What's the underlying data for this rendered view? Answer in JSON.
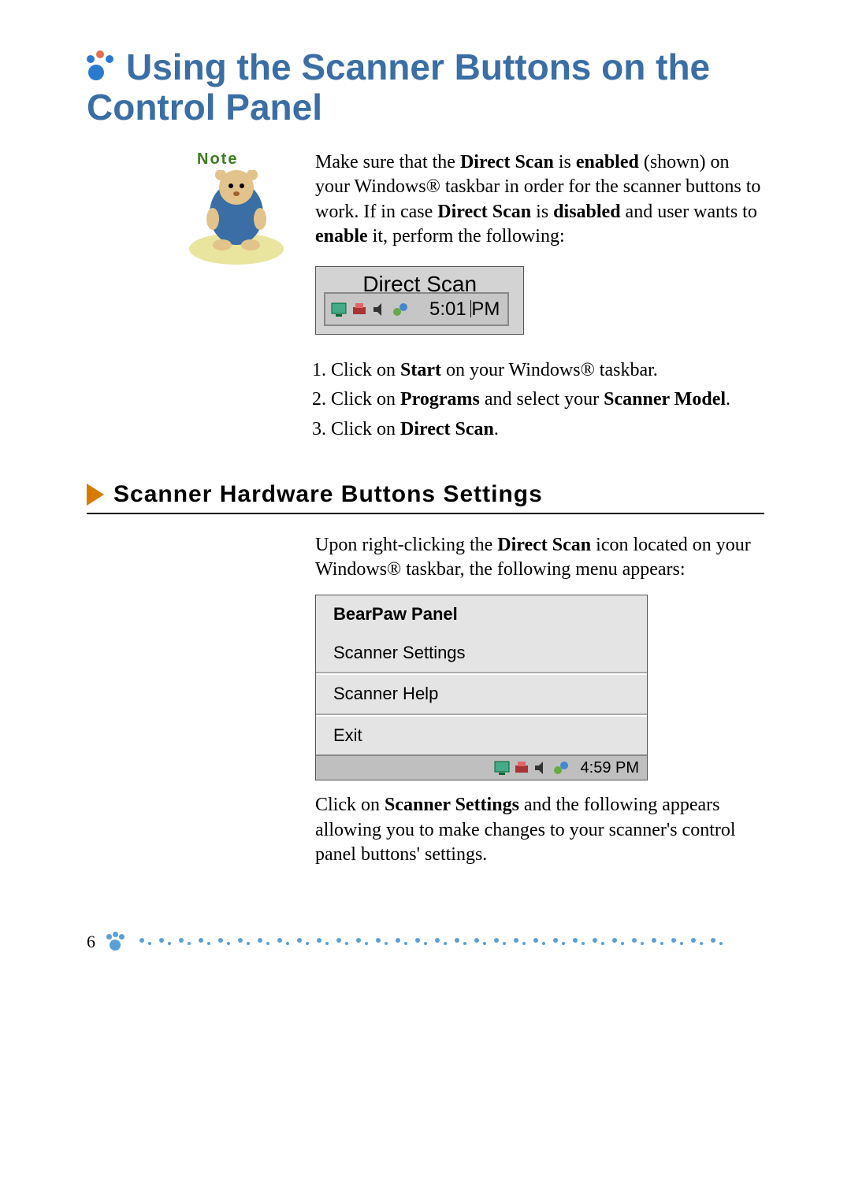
{
  "title": "Using the Scanner Buttons on the Control Panel",
  "note_label": "Note",
  "note_para_parts": {
    "p1": "Make sure that the ",
    "b1": "Direct Scan",
    "p2": " is ",
    "b2": "enabled",
    "p3": " (shown) on your Windows® taskbar in order for the scanner buttons to work. If in case ",
    "b3": "Direct Scan",
    "p4": " is ",
    "b4": "disabled",
    "p5": " and user wants to ",
    "b5": "enable",
    "p6": " it, perform the following:"
  },
  "taskbar_fig": {
    "label": "Direct Scan",
    "time": "5:01 PM"
  },
  "steps": [
    {
      "pre": "Click on ",
      "b": "Start",
      "post": " on your Windows® taskbar."
    },
    {
      "pre": "Click on ",
      "b": "Programs",
      "mid": " and select your ",
      "b2": "Scanner Model",
      "post": "."
    },
    {
      "pre": "Click on ",
      "b": "Direct Scan",
      "post": "."
    }
  ],
  "section_heading": "Scanner Hardware Buttons Settings",
  "section_para1": {
    "p1": "Upon right-clicking the ",
    "b1": "Direct Scan",
    "p2": " icon located on your Windows® taskbar, the following menu appears:"
  },
  "context_menu": {
    "item1": "BearPaw Panel",
    "item2": "Scanner Settings",
    "item3": "Scanner Help",
    "item4": "Exit",
    "time": "4:59 PM"
  },
  "section_para2": {
    "p1": "Click on ",
    "b1": "Scanner Settings",
    "p2": " and the following appears allowing you to make changes to your scanner's control panel buttons' settings."
  },
  "page_number": "6"
}
